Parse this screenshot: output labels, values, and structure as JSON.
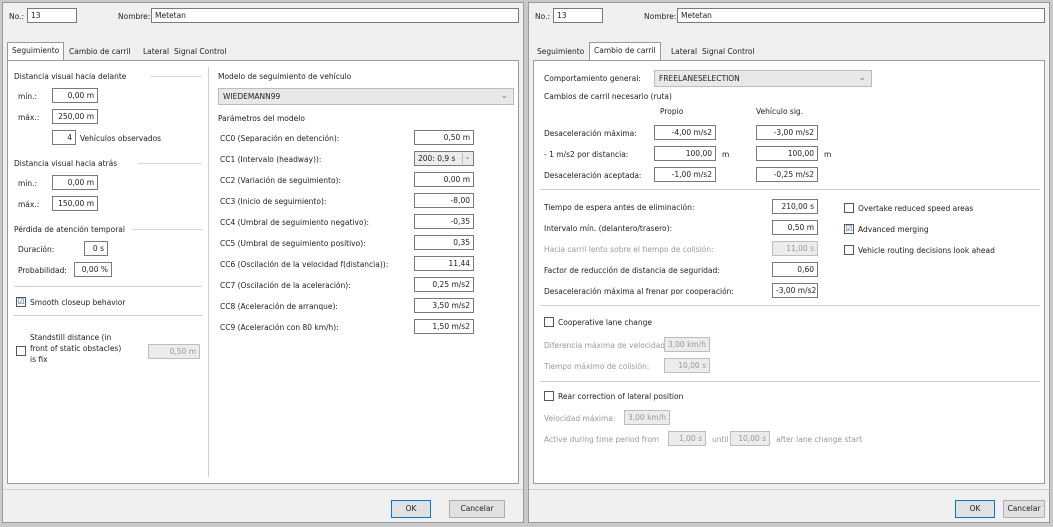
{
  "left": {
    "header": {
      "no_label": "No.:",
      "no_value": "13",
      "name_label": "Nombre:",
      "name_value": "Metetan"
    },
    "tabs": [
      "Seguimiento",
      "Cambio de carril",
      "Lateral",
      "Signal Control"
    ],
    "vis_ahead": {
      "title": "Distancia visual hacia delante",
      "min_label": "mín.:",
      "min_value": "0,00 m",
      "max_label": "máx.:",
      "max_value": "250,00 m",
      "veh_value": "4",
      "veh_label": "Vehículos observados"
    },
    "vis_back": {
      "title": "Distancia visual hacia atrás",
      "min_label": "mín.:",
      "min_value": "0,00 m",
      "max_label": "máx.:",
      "max_value": "150,00 m"
    },
    "attention": {
      "title": "Pérdida de atención temporal",
      "dur_label": "Duración:",
      "dur_value": "0 s",
      "prob_label": "Probabilidad:",
      "prob_value": "0,00 %"
    },
    "smooth": {
      "label": "Smooth closeup behavior",
      "checked": "☑"
    },
    "standstill": {
      "label1": "Standstill distance (in",
      "label2": "front of static obstacles)",
      "label3": "is fix",
      "value": "0,50 m"
    },
    "model": {
      "title": "Modelo de seguimiento de vehículo",
      "selected": "WIEDEMANN99",
      "arrow": "⌄",
      "params_title": "Parámetros del modelo",
      "params": [
        {
          "label": "CC0 (Separación en detención):",
          "value": "0,50 m"
        },
        {
          "label": "CC1 (Intervalo (headway)):",
          "value": "200: 0,9 s"
        },
        {
          "label": "CC2 (Variación de seguimiento):",
          "value": "0,00 m"
        },
        {
          "label": "CC3 (Inicio de seguimiento):",
          "value": "-8,00"
        },
        {
          "label": "CC4 (Umbral de seguimiento negativo):",
          "value": "-0,35"
        },
        {
          "label": "CC5 (Umbral de seguimiento positivo):",
          "value": "0,35"
        },
        {
          "label": "CC6 (Oscilación de la velocidad f(distancia)):",
          "value": "11,44"
        },
        {
          "label": "CC7 (Oscilación de la aceleración):",
          "value": "0,25 m/s2"
        },
        {
          "label": "CC8 (Aceleración de arranque):",
          "value": "3,50 m/s2"
        },
        {
          "label": "CC9 (Aceleración con 80 km/h):",
          "value": "1,50 m/s2"
        }
      ]
    },
    "footer": {
      "ok": "OK",
      "cancel": "Cancelar"
    }
  },
  "right": {
    "header": {
      "no_label": "No.:",
      "no_value": "13",
      "name_label": "Nombre:",
      "name_value": "Metetan"
    },
    "tabs": [
      "Seguimiento",
      "Cambio de carril",
      "Lateral",
      "Signal Control"
    ],
    "general": {
      "label": "Comportamiento general:",
      "value": "FREELANESELECTION",
      "arrow": "⌄"
    },
    "necessary": {
      "title": "Cambios de carril necesario (ruta)",
      "col_own": "Propio",
      "col_trail": "Vehículo sig.",
      "rows": [
        {
          "label": "Desaceleración máxima:",
          "own": "-4,00 m/s2",
          "trail": "-3,00 m/s2",
          "unit": ""
        },
        {
          "label": "- 1 m/s2 por distancia:",
          "own": "100,00",
          "trail": "100,00",
          "unit": "m"
        },
        {
          "label": "Desaceleración aceptada:",
          "own": "-1,00 m/s2",
          "trail": "-0,25 m/s2",
          "unit": ""
        }
      ]
    },
    "params": [
      {
        "label": "Tiempo de espera antes de eliminación:",
        "value": "210,00 s"
      },
      {
        "label": "Intervalo mín. (delantero/trasero):",
        "value": "0,50 m"
      },
      {
        "label": "Hacia carril lento sobre el tiempo de colisión:",
        "value": "11,00 s"
      },
      {
        "label": "Factor de reducción de distancia de seguridad:",
        "value": "0,60"
      },
      {
        "label": "Desaceleración máxima al frenar por cooperación:",
        "value": "-3,00 m/s2"
      }
    ],
    "options": [
      {
        "label": "Overtake reduced speed areas",
        "checked": ""
      },
      {
        "label": "Advanced merging",
        "checked": "☑"
      },
      {
        "label": "Vehicle routing decisions look ahead",
        "checked": ""
      }
    ],
    "coop": {
      "label": "Cooperative lane change",
      "diff_label": "Diferencia máxima de velocidad:",
      "diff_value": "3,00 km/h",
      "time_label": "Tiempo máximo de colisión:",
      "time_value": "10,00 s"
    },
    "rear": {
      "label": "Rear correction of lateral position",
      "speed_label": "Velocidad máxima:",
      "speed_value": "3,00 km/h",
      "active_label": "Active during time period from",
      "from_value": "1,00 s",
      "until_label": "until",
      "until_value": "10,00 s",
      "after_label": "after lane change start"
    },
    "footer": {
      "ok": "OK",
      "cancel": "Cancelar"
    }
  }
}
